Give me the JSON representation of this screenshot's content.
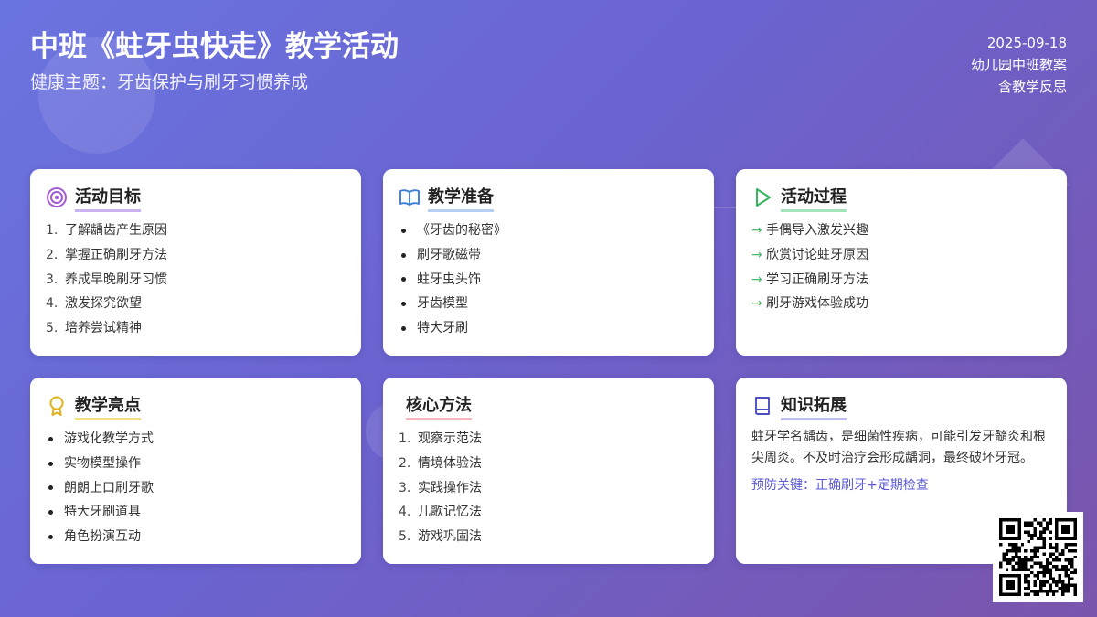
{
  "header": {
    "title": "中班《蛀牙虫快走》教学活动",
    "subtitle": "健康主题：牙齿保护与刷牙习惯养成",
    "date": "2025-09-18",
    "meta_1": "幼儿园中班教案",
    "meta_2": "含教学反思"
  },
  "cards": {
    "goals": {
      "title": "活动目标",
      "icon": "target-icon",
      "items": [
        "了解龋齿产生原因",
        "掌握正确刷牙方法",
        "养成早晚刷牙习惯",
        "激发探究欲望",
        "培养尝试精神"
      ]
    },
    "prep": {
      "title": "教学准备",
      "icon": "open-book-icon",
      "items": [
        "《牙齿的秘密》",
        "刷牙歌磁带",
        "蛀牙虫头饰",
        "牙齿模型",
        "特大牙刷"
      ]
    },
    "process": {
      "title": "活动过程",
      "icon": "play-icon",
      "items": [
        "手偶导入激发兴趣",
        "欣赏讨论蛀牙原因",
        "学习正确刷牙方法",
        "刷牙游戏体验成功"
      ]
    },
    "highlights": {
      "title": "教学亮点",
      "icon": "award-icon",
      "items": [
        "游戏化教学方式",
        "实物模型操作",
        "朗朗上口刷牙歌",
        "特大牙刷道具",
        "角色扮演互动"
      ]
    },
    "methods": {
      "title": "核心方法",
      "items": [
        "观察示范法",
        "情境体验法",
        "实践操作法",
        "儿歌记忆法",
        "游戏巩固法"
      ]
    },
    "knowledge": {
      "title": "知识拓展",
      "icon": "book-icon",
      "text": "蛀牙学名龋齿，是细菌性疾病，可能引发牙髓炎和根尖周炎。不及时治疗会形成龋洞，最终破坏牙冠。",
      "key": "预防关键：正确刷牙+定期检查"
    }
  },
  "colors": {
    "background_start": "#6a74e0",
    "background_end": "#7a55ac",
    "accent_text": "#5b59d6",
    "arrow": "#4ab868"
  }
}
